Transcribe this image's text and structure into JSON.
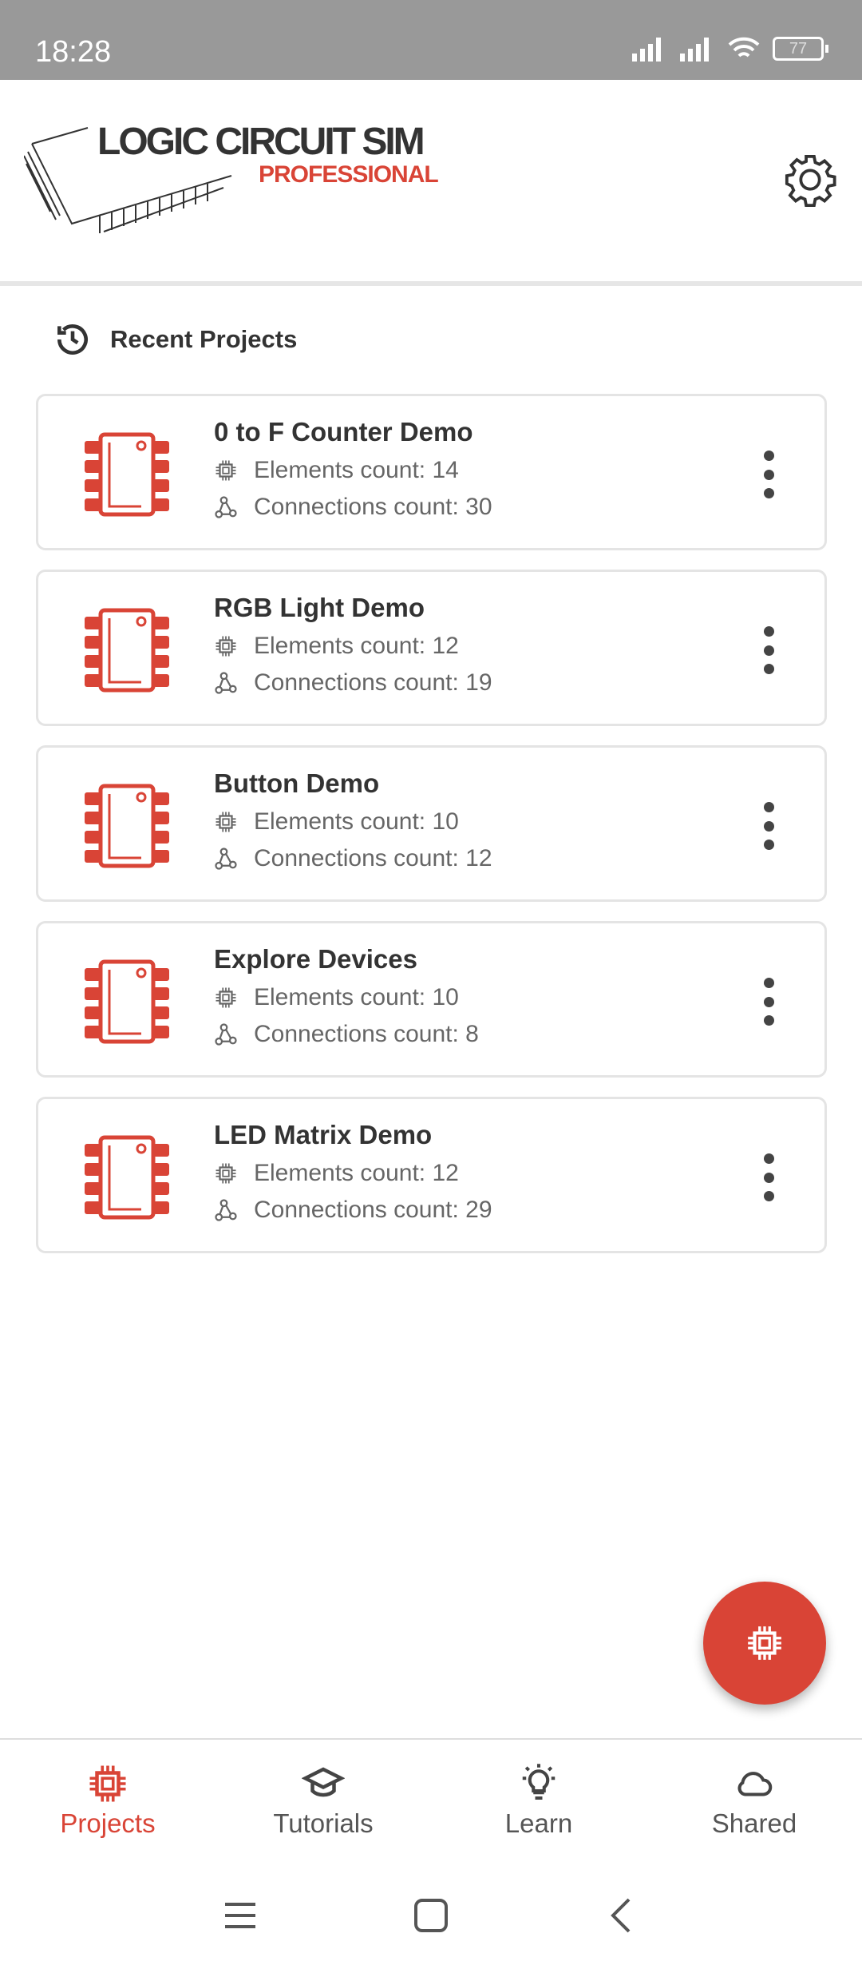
{
  "status_bar": {
    "time": "18:28",
    "battery": "77"
  },
  "header": {
    "logo_title": "LOGIC CIRCUIT SIM",
    "logo_subtitle": "PROFESSIONAL",
    "settings_icon": "gear-icon"
  },
  "recent": {
    "label": "Recent Projects",
    "icon": "history-icon"
  },
  "projects": [
    {
      "title": "0 to F Counter Demo",
      "elements": "Elements count: 14",
      "connections": "Connections count: 30"
    },
    {
      "title": "RGB Light Demo",
      "elements": "Elements count: 12",
      "connections": "Connections count: 19"
    },
    {
      "title": "Button Demo",
      "elements": "Elements count: 10",
      "connections": "Connections count: 12"
    },
    {
      "title": "Explore Devices",
      "elements": "Elements count: 10",
      "connections": "Connections count: 8"
    },
    {
      "title": "LED Matrix Demo",
      "elements": "Elements count: 12",
      "connections": "Connections count: 29"
    }
  ],
  "nav": [
    {
      "label": "Projects",
      "icon": "chip-icon",
      "active": true
    },
    {
      "label": "Tutorials",
      "icon": "graduation-cap-icon"
    },
    {
      "label": "Learn",
      "icon": "lightbulb-icon"
    },
    {
      "label": "Shared",
      "icon": "cloud-icon"
    }
  ],
  "colors": {
    "accent": "#d94436",
    "status_bar": "#999999"
  }
}
